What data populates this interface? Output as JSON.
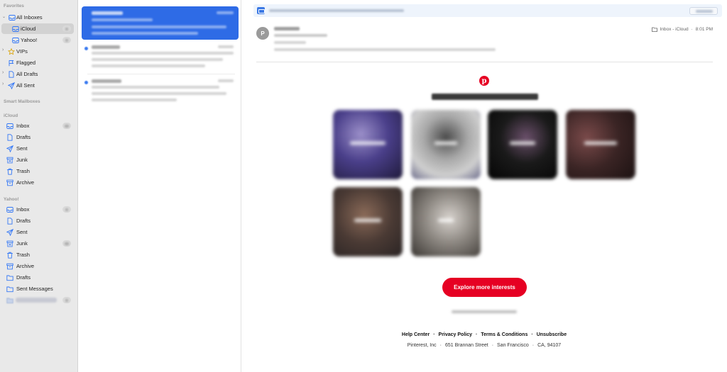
{
  "sidebar": {
    "favorites_header": "Favorites",
    "all_inboxes": "All Inboxes",
    "icloud": "iCloud",
    "yahoo": "Yahoo!",
    "vips": "VIPs",
    "flagged": "Flagged",
    "all_drafts": "All Drafts",
    "all_sent": "All Sent",
    "smart_mailboxes_header": "Smart Mailboxes",
    "icloud_header": "iCloud",
    "icloud_items": [
      "Inbox",
      "Drafts",
      "Sent",
      "Junk",
      "Trash",
      "Archive"
    ],
    "yahoo_header": "Yahoo!",
    "yahoo_items": [
      "Inbox",
      "Drafts",
      "Sent",
      "Junk",
      "Trash",
      "Archive",
      "Drafts",
      "Sent Messages"
    ]
  },
  "reader": {
    "avatar_initial": "P",
    "mailbox_label": "Inbox - iCloud",
    "time": "8:01 PM",
    "cta_label": "Explore more interests",
    "footer_links": [
      "Help Center",
      "Privacy Policy",
      "Terms & Conditions",
      "Unsubscribe"
    ],
    "footer_address": [
      "Pinterest, Inc",
      "651 Brannan Street",
      "San Francisco",
      "CA, 94107"
    ]
  },
  "colors": {
    "accent": "#2e6be6",
    "brand": "#e60023",
    "sidebar_bg": "#e9e9e9",
    "sidebar_icon": "#3478f6"
  }
}
